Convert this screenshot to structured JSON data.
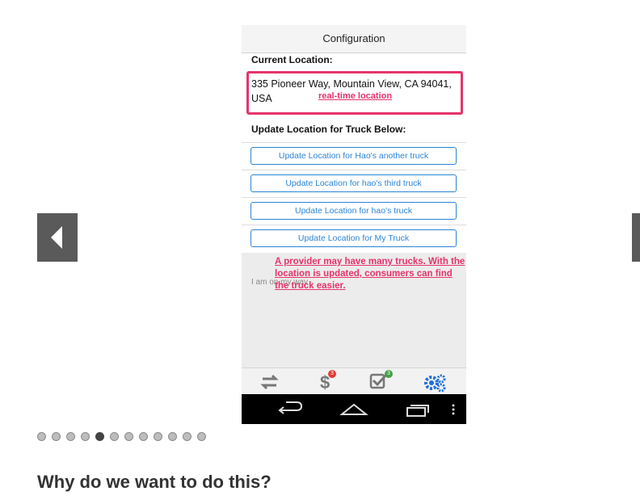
{
  "app": {
    "title": "Configuration",
    "current_location_label": "Current Location:",
    "address": "335 Pioneer Way, Mountain View, CA 94041, USA",
    "update_label": "Update Location for Truck Below:",
    "trucks": [
      {
        "label": "Update Location for Hao's another truck"
      },
      {
        "label": "Update Location for hao's third truck"
      },
      {
        "label": "Update Location for hao's truck"
      },
      {
        "label": "Update Location for My Truck"
      }
    ],
    "notes_placeholder": "I am on my way",
    "tabs": [
      {
        "icon": "transfer-arrows-icon",
        "badge": ""
      },
      {
        "icon": "dollar-icon",
        "badge": "3",
        "badge_color": "#e53935"
      },
      {
        "icon": "checkbox-icon",
        "badge": "3",
        "badge_color": "#43a047"
      },
      {
        "icon": "gears-icon",
        "badge": "",
        "active_color": "#1e6fd9"
      }
    ],
    "nav": [
      {
        "icon": "back-icon"
      },
      {
        "icon": "home-icon"
      },
      {
        "icon": "recent-apps-icon"
      },
      {
        "icon": "overflow-menu-icon"
      }
    ]
  },
  "annotations": {
    "realtime": "real-time location",
    "providers": "A provider may have many trucks. With the location is updated, consumers can find the truck easier.",
    "color": "#e6336b"
  },
  "carousel": {
    "slide_count": 12,
    "active_index": 4
  },
  "section": {
    "heading": "Why do we want to do this?"
  }
}
